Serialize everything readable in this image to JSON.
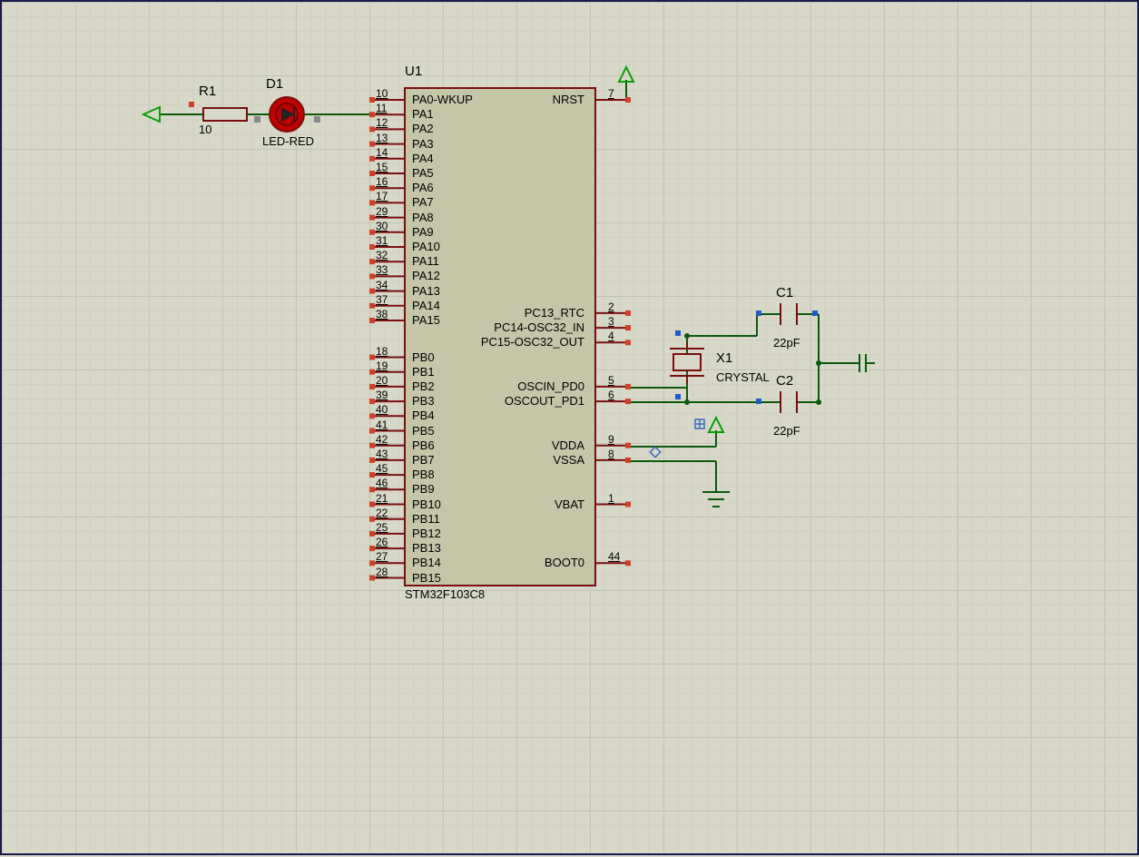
{
  "mcu": {
    "designator": "U1",
    "part": "STM32F103C8",
    "pins_left": [
      {
        "num": "10",
        "name": "PA0-WKUP"
      },
      {
        "num": "11",
        "name": "PA1"
      },
      {
        "num": "12",
        "name": "PA2"
      },
      {
        "num": "13",
        "name": "PA3"
      },
      {
        "num": "14",
        "name": "PA4"
      },
      {
        "num": "15",
        "name": "PA5"
      },
      {
        "num": "16",
        "name": "PA6"
      },
      {
        "num": "17",
        "name": "PA7"
      },
      {
        "num": "29",
        "name": "PA8"
      },
      {
        "num": "30",
        "name": "PA9"
      },
      {
        "num": "31",
        "name": "PA10"
      },
      {
        "num": "32",
        "name": "PA11"
      },
      {
        "num": "33",
        "name": "PA12"
      },
      {
        "num": "34",
        "name": "PA13"
      },
      {
        "num": "37",
        "name": "PA14"
      },
      {
        "num": "38",
        "name": "PA15"
      },
      {
        "num": "18",
        "name": "PB0"
      },
      {
        "num": "19",
        "name": "PB1"
      },
      {
        "num": "20",
        "name": "PB2"
      },
      {
        "num": "39",
        "name": "PB3"
      },
      {
        "num": "40",
        "name": "PB4"
      },
      {
        "num": "41",
        "name": "PB5"
      },
      {
        "num": "42",
        "name": "PB6"
      },
      {
        "num": "43",
        "name": "PB7"
      },
      {
        "num": "45",
        "name": "PB8"
      },
      {
        "num": "46",
        "name": "PB9"
      },
      {
        "num": "21",
        "name": "PB10"
      },
      {
        "num": "22",
        "name": "PB11"
      },
      {
        "num": "25",
        "name": "PB12"
      },
      {
        "num": "26",
        "name": "PB13"
      },
      {
        "num": "27",
        "name": "PB14"
      },
      {
        "num": "28",
        "name": "PB15"
      }
    ],
    "pins_right": [
      {
        "num": "7",
        "name": "NRST",
        "row": 0
      },
      {
        "num": "2",
        "name": "PC13_RTC",
        "row": 14.5
      },
      {
        "num": "3",
        "name": "PC14-OSC32_IN",
        "row": 15.5
      },
      {
        "num": "4",
        "name": "PC15-OSC32_OUT",
        "row": 16.5
      },
      {
        "num": "5",
        "name": "OSCIN_PD0",
        "row": 19.5
      },
      {
        "num": "6",
        "name": "OSCOUT_PD1",
        "row": 20.5
      },
      {
        "num": "9",
        "name": "VDDA",
        "row": 23.5
      },
      {
        "num": "8",
        "name": "VSSA",
        "row": 24.5
      },
      {
        "num": "1",
        "name": "VBAT",
        "row": 27.5
      },
      {
        "num": "44",
        "name": "BOOT0",
        "row": 31.5
      }
    ]
  },
  "resistor": {
    "designator": "R1",
    "value": "10"
  },
  "led": {
    "designator": "D1",
    "value": "LED-RED"
  },
  "crystal": {
    "designator": "X1",
    "value": "CRYSTAL"
  },
  "cap1": {
    "designator": "C1",
    "value": "22pF"
  },
  "cap2": {
    "designator": "C2",
    "value": "22pF"
  }
}
